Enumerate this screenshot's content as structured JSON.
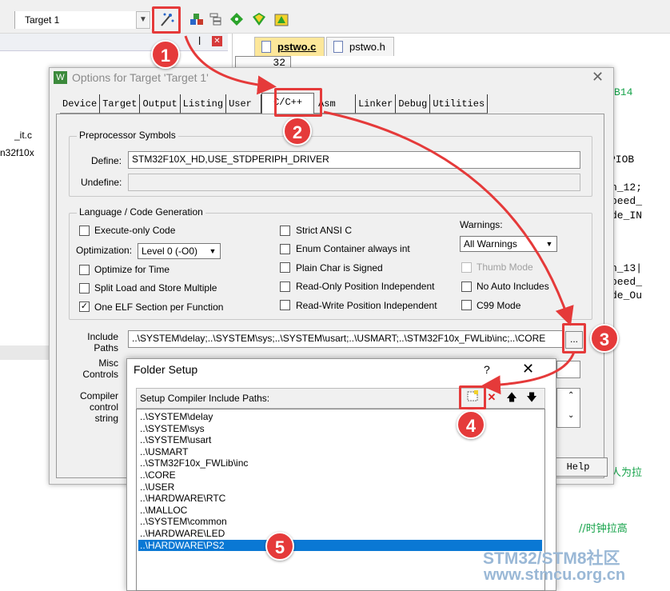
{
  "toolbar": {
    "target": "Target 1",
    "icons": [
      "options-for-target-icon",
      "load-icon",
      "manage-project-icon",
      "pack-installer-icon",
      "select-device-icon",
      "software-packs-icon"
    ]
  },
  "project": {
    "items": [
      "_it.c",
      "n32f10x"
    ]
  },
  "editor": {
    "tabs": [
      "pstwo.c",
      "pstwo.h"
    ],
    "line_number": "32",
    "code_snippets": [
      "B14",
      "PIOB",
      "n_12;",
      "peed_",
      "de_IN",
      "n_13|",
      "peed_",
      "de_Ou",
      "人为拉",
      "//时钟拉高"
    ]
  },
  "options_dialog": {
    "title": "Options for Target 'Target 1'",
    "tabs": [
      "Device",
      "Target",
      "Output",
      "Listing",
      "User",
      "C/C++",
      "Asm",
      "Linker",
      "Debug",
      "Utilities"
    ],
    "preprocessor": {
      "title": "Preprocessor Symbols",
      "define_label": "Define:",
      "define_value": "STM32F10X_HD,USE_STDPERIPH_DRIVER",
      "undefine_label": "Undefine:",
      "undefine_value": ""
    },
    "codegen": {
      "title": "Language / Code Generation",
      "execute_only": "Execute-only Code",
      "optimization_label": "Optimization:",
      "optimization_value": "Level 0 (-O0)",
      "optimize_time": "Optimize for Time",
      "split_load": "Split Load and Store Multiple",
      "one_elf": "One ELF Section per Function",
      "strict_ansi": "Strict ANSI C",
      "enum_container": "Enum Container always int",
      "plain_char": "Plain Char is Signed",
      "ro_pi": "Read-Only Position Independent",
      "rw_pi": "Read-Write Position Independent",
      "warnings_label": "Warnings:",
      "warnings_value": "All Warnings",
      "thumb_mode": "Thumb Mode",
      "no_auto_includes": "No Auto Includes",
      "c99_mode": "C99 Mode"
    },
    "include_label": "Include Paths",
    "include_value": "..\\SYSTEM\\delay;..\\SYSTEM\\sys;..\\SYSTEM\\usart;..\\USMART;..\\STM32F10x_FWLib\\inc;..\\CORE",
    "ellipsis": "...",
    "misc_label": "Misc Controls",
    "compiler_label": "Compiler control string",
    "help_label": "Help"
  },
  "folder_setup": {
    "title": "Folder Setup",
    "help": "?",
    "close": "✕",
    "list_label": "Setup Compiler Include Paths:",
    "paths": [
      "..\\SYSTEM\\delay",
      "..\\SYSTEM\\sys",
      "..\\SYSTEM\\usart",
      "..\\USMART",
      "..\\STM32F10x_FWLib\\inc",
      "..\\CORE",
      "..\\USER",
      "..\\HARDWARE\\RTC",
      "..\\MALLOC",
      "..\\SYSTEM\\common",
      "..\\HARDWARE\\LED",
      "..\\HARDWARE\\PS2"
    ],
    "selected_index": 11
  },
  "annotations": {
    "badges": [
      "1",
      "2",
      "3",
      "4",
      "5"
    ],
    "accent_color": "#e53a3a"
  },
  "watermark": {
    "line1": "STM32/STM8社区",
    "line2": "www.stmcu.org.cn"
  }
}
